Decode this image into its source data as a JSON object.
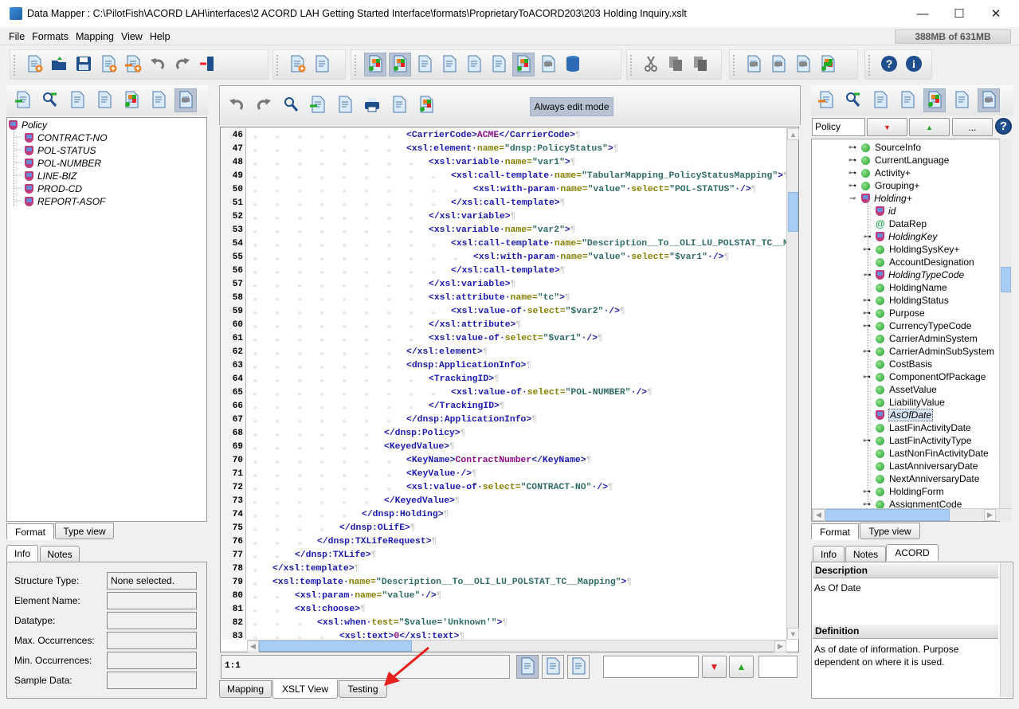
{
  "window": {
    "title": "Data Mapper : C:\\PilotFish\\ACORD LAH\\interfaces\\2 ACORD LAH Getting Started Interface\\formats\\ProprietaryToACORD203\\203 Holding Inquiry.xslt",
    "minimize": "—",
    "maximize": "☐",
    "close": "✕"
  },
  "menu": [
    "File",
    "Formats",
    "Mapping",
    "View",
    "Help"
  ],
  "memory": "388MB of 631MB",
  "toolbar_groups": [
    [
      {
        "icon": "new-format-icon"
      },
      {
        "icon": "open-folder-icon"
      },
      {
        "icon": "save-icon"
      },
      {
        "icon": "save-as-icon"
      },
      {
        "icon": "export-xls-icon"
      },
      {
        "icon": "undo-icon"
      },
      {
        "icon": "redo-icon"
      },
      {
        "icon": "exit-door-icon"
      }
    ],
    [
      {
        "icon": "add-mapping-icon"
      },
      {
        "icon": "mapping-settings-icon"
      }
    ],
    [
      {
        "icon": "info-view-icon",
        "active": true
      },
      {
        "icon": "color-view-icon",
        "active": true
      },
      {
        "icon": "validate-checklist-icon"
      },
      {
        "icon": "xslt-source-icon"
      },
      {
        "icon": "save-schedule-icon"
      },
      {
        "icon": "document-stack-icon"
      },
      {
        "icon": "at-view-icon",
        "active": true
      },
      {
        "icon": "tree-table-icon"
      },
      {
        "icon": "database-icon"
      }
    ],
    [
      {
        "icon": "cut-icon"
      },
      {
        "icon": "copy-icon"
      },
      {
        "icon": "paste-icon"
      }
    ],
    [
      {
        "icon": "move-up-icon"
      },
      {
        "icon": "move-center-icon"
      },
      {
        "icon": "move-down-icon"
      },
      {
        "icon": "color-table-icon"
      }
    ],
    [
      {
        "icon": "help-icon"
      },
      {
        "icon": "about-info-icon"
      }
    ]
  ],
  "left_panel": {
    "toolbar": [
      {
        "icon": "import-format-icon"
      },
      {
        "icon": "find-node-icon"
      },
      {
        "icon": "notepad-icon"
      },
      {
        "icon": "structure-list-icon"
      },
      {
        "icon": "inspect-icon"
      },
      {
        "icon": "edit-icon"
      },
      {
        "icon": "tree-select-icon",
        "active": true
      }
    ],
    "tree": {
      "root": "Policy",
      "children": [
        "CONTRACT-NO",
        "POL-STATUS",
        "POL-NUMBER",
        "LINE-BIZ",
        "PROD-CD",
        "REPORT-ASOF"
      ]
    },
    "view_tabs": [
      "Format",
      "Type view"
    ],
    "info_tabs": [
      "Info",
      "Notes"
    ],
    "info_form": [
      {
        "label": "Structure Type:",
        "value": "None selected."
      },
      {
        "label": "Element Name:",
        "value": ""
      },
      {
        "label": "Datatype:",
        "value": ""
      },
      {
        "label": "Max. Occurrences:",
        "value": ""
      },
      {
        "label": "Min. Occurrences:",
        "value": ""
      },
      {
        "label": "Sample Data:",
        "value": ""
      }
    ]
  },
  "center": {
    "toolbar": [
      {
        "icon": "undo-icon"
      },
      {
        "icon": "redo-icon"
      },
      {
        "icon": "search-icon"
      },
      {
        "icon": "download-doc-icon"
      },
      {
        "icon": "validate-checklist-icon"
      },
      {
        "icon": "print-icon"
      },
      {
        "icon": "comment-icon"
      },
      {
        "icon": "color-view-icon"
      }
    ],
    "always_edit_mode": "Always edit mode",
    "code_lines": [
      {
        "n": 46,
        "indent": 7,
        "code": "<CarrierCode>ACME</CarrierCode>"
      },
      {
        "n": 47,
        "indent": 7,
        "code": "<xsl:element name=\"dnsp:PolicyStatus\">"
      },
      {
        "n": 48,
        "indent": 8,
        "code": "<xsl:variable name=\"var1\">"
      },
      {
        "n": 49,
        "indent": 9,
        "code": "<xsl:call-template name=\"TabularMapping_PolicyStatusMapping\">"
      },
      {
        "n": 50,
        "indent": 10,
        "code": "<xsl:with-param name=\"value\" select=\"POL-STATUS\" />"
      },
      {
        "n": 51,
        "indent": 9,
        "code": "</xsl:call-template>"
      },
      {
        "n": 52,
        "indent": 8,
        "code": "</xsl:variable>"
      },
      {
        "n": 53,
        "indent": 8,
        "code": "<xsl:variable name=\"var2\">"
      },
      {
        "n": 54,
        "indent": 9,
        "code": "<xsl:call-template name=\"Description__To__OLI_LU_POLSTAT_TC__Mapping\">"
      },
      {
        "n": 55,
        "indent": 10,
        "code": "<xsl:with-param name=\"value\" select=\"$var1\" />"
      },
      {
        "n": 56,
        "indent": 9,
        "code": "</xsl:call-template>"
      },
      {
        "n": 57,
        "indent": 8,
        "code": "</xsl:variable>"
      },
      {
        "n": 58,
        "indent": 8,
        "code": "<xsl:attribute name=\"tc\">"
      },
      {
        "n": 59,
        "indent": 9,
        "code": "<xsl:value-of select=\"$var2\" />"
      },
      {
        "n": 60,
        "indent": 8,
        "code": "</xsl:attribute>"
      },
      {
        "n": 61,
        "indent": 8,
        "code": "<xsl:value-of select=\"$var1\" />"
      },
      {
        "n": 62,
        "indent": 7,
        "code": "</xsl:element>"
      },
      {
        "n": 63,
        "indent": 7,
        "code": "<dnsp:ApplicationInfo>"
      },
      {
        "n": 64,
        "indent": 8,
        "code": "<TrackingID>"
      },
      {
        "n": 65,
        "indent": 9,
        "code": "<xsl:value-of select=\"POL-NUMBER\" />"
      },
      {
        "n": 66,
        "indent": 8,
        "code": "</TrackingID>"
      },
      {
        "n": 67,
        "indent": 7,
        "code": "</dnsp:ApplicationInfo>"
      },
      {
        "n": 68,
        "indent": 6,
        "code": "</dnsp:Policy>"
      },
      {
        "n": 69,
        "indent": 6,
        "code": "<KeyedValue>"
      },
      {
        "n": 70,
        "indent": 7,
        "code": "<KeyName>ContractNumber</KeyName>"
      },
      {
        "n": 71,
        "indent": 7,
        "code": "<KeyValue />"
      },
      {
        "n": 72,
        "indent": 7,
        "code": "<xsl:value-of select=\"CONTRACT-NO\" />"
      },
      {
        "n": 73,
        "indent": 6,
        "code": "</KeyedValue>"
      },
      {
        "n": 74,
        "indent": 5,
        "code": "</dnsp:Holding>"
      },
      {
        "n": 75,
        "indent": 4,
        "code": "</dnsp:OLifE>"
      },
      {
        "n": 76,
        "indent": 3,
        "code": "</dnsp:TXLifeRequest>"
      },
      {
        "n": 77,
        "indent": 2,
        "code": "</dnsp:TXLife>"
      },
      {
        "n": 78,
        "indent": 1,
        "code": "</xsl:template>"
      },
      {
        "n": 79,
        "indent": 1,
        "code": "<xsl:template name=\"Description__To__OLI_LU_POLSTAT_TC__Mapping\">"
      },
      {
        "n": 80,
        "indent": 2,
        "code": "<xsl:param name=\"value\" />"
      },
      {
        "n": 81,
        "indent": 2,
        "code": "<xsl:choose>"
      },
      {
        "n": 82,
        "indent": 3,
        "code": "<xsl:when test=\"$value='Unknown'\">"
      },
      {
        "n": 83,
        "indent": 4,
        "code": "<xsl:text>0</xsl:text>"
      }
    ],
    "cursor_position": "1:1",
    "status_icons": [
      {
        "icon": "validated-doc-icon",
        "active": true
      },
      {
        "icon": "document-icon"
      },
      {
        "icon": "document-list-icon"
      }
    ],
    "find_down": "find-next-icon",
    "find_up": "find-previous-icon",
    "bottom_tabs": [
      "Mapping",
      "XSLT View",
      "Testing"
    ],
    "active_tab": "XSLT View"
  },
  "right_panel": {
    "toolbar": [
      {
        "icon": "export-format-icon"
      },
      {
        "icon": "find-node-icon"
      },
      {
        "icon": "notepad-icon"
      },
      {
        "icon": "structure-list-icon"
      },
      {
        "icon": "inspect-icon",
        "active": true
      },
      {
        "icon": "edit-icon"
      },
      {
        "icon": "tree-select-icon",
        "active": true
      }
    ],
    "search_value": "Policy",
    "more_button": "...",
    "tree": [
      {
        "label": "SourceInfo",
        "level": 0,
        "exp": "+",
        "icon": "dot"
      },
      {
        "label": "CurrentLanguage",
        "level": 0,
        "exp": "+",
        "icon": "dot"
      },
      {
        "label": "Activity+",
        "level": 0,
        "exp": "+",
        "icon": "dot"
      },
      {
        "label": "Grouping+",
        "level": 0,
        "exp": "+",
        "icon": "dot"
      },
      {
        "label": "Holding+",
        "level": 0,
        "exp": "-",
        "icon": "shield",
        "italic": true
      },
      {
        "label": "id",
        "level": 1,
        "icon": "shield",
        "italic": true
      },
      {
        "label": "DataRep",
        "level": 1,
        "icon": "at"
      },
      {
        "label": "HoldingKey",
        "level": 1,
        "exp": "+",
        "icon": "shield",
        "italic": true
      },
      {
        "label": "HoldingSysKey+",
        "level": 1,
        "exp": "+",
        "icon": "dot"
      },
      {
        "label": "AccountDesignation",
        "level": 1,
        "icon": "dot"
      },
      {
        "label": "HoldingTypeCode",
        "level": 1,
        "exp": "+",
        "icon": "shield",
        "italic": true
      },
      {
        "label": "HoldingName",
        "level": 1,
        "icon": "dot"
      },
      {
        "label": "HoldingStatus",
        "level": 1,
        "exp": "+",
        "icon": "dot"
      },
      {
        "label": "Purpose",
        "level": 1,
        "exp": "+",
        "icon": "dot"
      },
      {
        "label": "CurrencyTypeCode",
        "level": 1,
        "exp": "+",
        "icon": "dot"
      },
      {
        "label": "CarrierAdminSystem",
        "level": 1,
        "icon": "dot"
      },
      {
        "label": "CarrierAdminSubSystem",
        "level": 1,
        "exp": "+",
        "icon": "dot"
      },
      {
        "label": "CostBasis",
        "level": 1,
        "icon": "dot"
      },
      {
        "label": "ComponentOfPackage",
        "level": 1,
        "exp": "+",
        "icon": "dot"
      },
      {
        "label": "AssetValue",
        "level": 1,
        "icon": "dot"
      },
      {
        "label": "LiabilityValue",
        "level": 1,
        "icon": "dot"
      },
      {
        "label": "AsOfDate",
        "level": 1,
        "icon": "shield",
        "italic": true,
        "selected": true
      },
      {
        "label": "LastFinActivityDate",
        "level": 1,
        "icon": "dot"
      },
      {
        "label": "LastFinActivityType",
        "level": 1,
        "exp": "+",
        "icon": "dot"
      },
      {
        "label": "LastNonFinActivityDate",
        "level": 1,
        "icon": "dot"
      },
      {
        "label": "LastAnniversaryDate",
        "level": 1,
        "icon": "dot"
      },
      {
        "label": "NextAnniversaryDate",
        "level": 1,
        "icon": "dot"
      },
      {
        "label": "HoldingForm",
        "level": 1,
        "exp": "+",
        "icon": "dot"
      },
      {
        "label": "AssignmentCode",
        "level": 1,
        "exp": "+",
        "icon": "dot"
      }
    ],
    "view_tabs": [
      "Format",
      "Type view"
    ],
    "info_tabs": [
      "Info",
      "Notes",
      "ACORD"
    ],
    "description_header": "Description",
    "description": "As Of Date",
    "definition_header": "Definition",
    "definition": "As of date of information. Purpose dependent on where it is used."
  },
  "colors": {
    "tag": "#1a1ab0",
    "attr_name": "#858000",
    "attr_value": "#2f6b66",
    "text": "#8a0a8a",
    "annotation_arrow": "#e8201c",
    "active_button": "#b7c3d3"
  }
}
